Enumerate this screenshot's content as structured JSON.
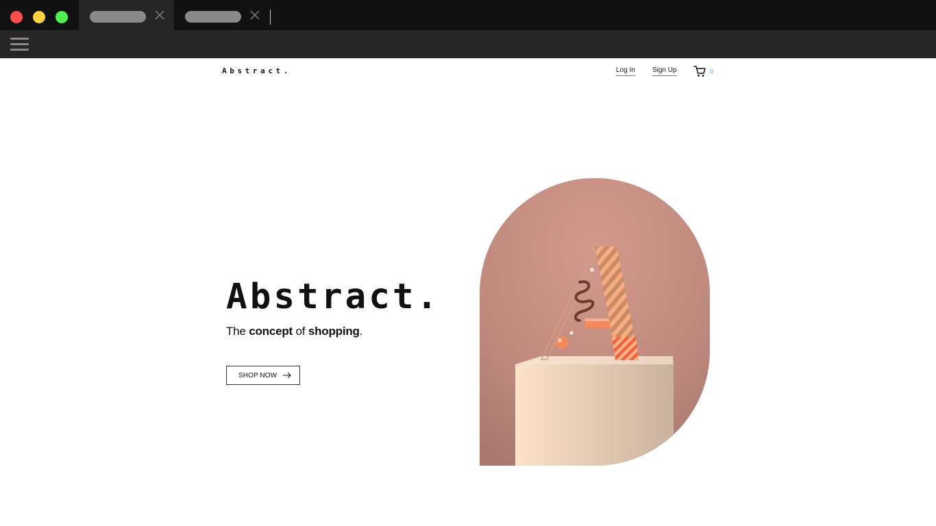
{
  "browser": {
    "tabs": [
      {
        "label": ""
      },
      {
        "label": ""
      }
    ]
  },
  "header": {
    "logo": "Abstract.",
    "login_label": "Log In",
    "signup_label": "Sign Up",
    "cart_count": "0",
    "cart_icon": "shopping-cart-icon"
  },
  "hero": {
    "title": "Abstract.",
    "subtitle": {
      "part1": "The ",
      "bold1": "concept",
      "part2": " of ",
      "bold2": "shopping",
      "part3": "."
    },
    "button_label": "SHOP NOW",
    "button_icon": "arrow-right-icon",
    "image": "pink-arch-with-3d-letter-a-on-pedestal"
  },
  "colors": {
    "accent_blue": "#5aa0e6",
    "arch_pink": "#c18e82",
    "pedestal": "#f3dbc3",
    "letter_peach": "#f7a27a",
    "letter_stripe": "#e07a4a"
  }
}
